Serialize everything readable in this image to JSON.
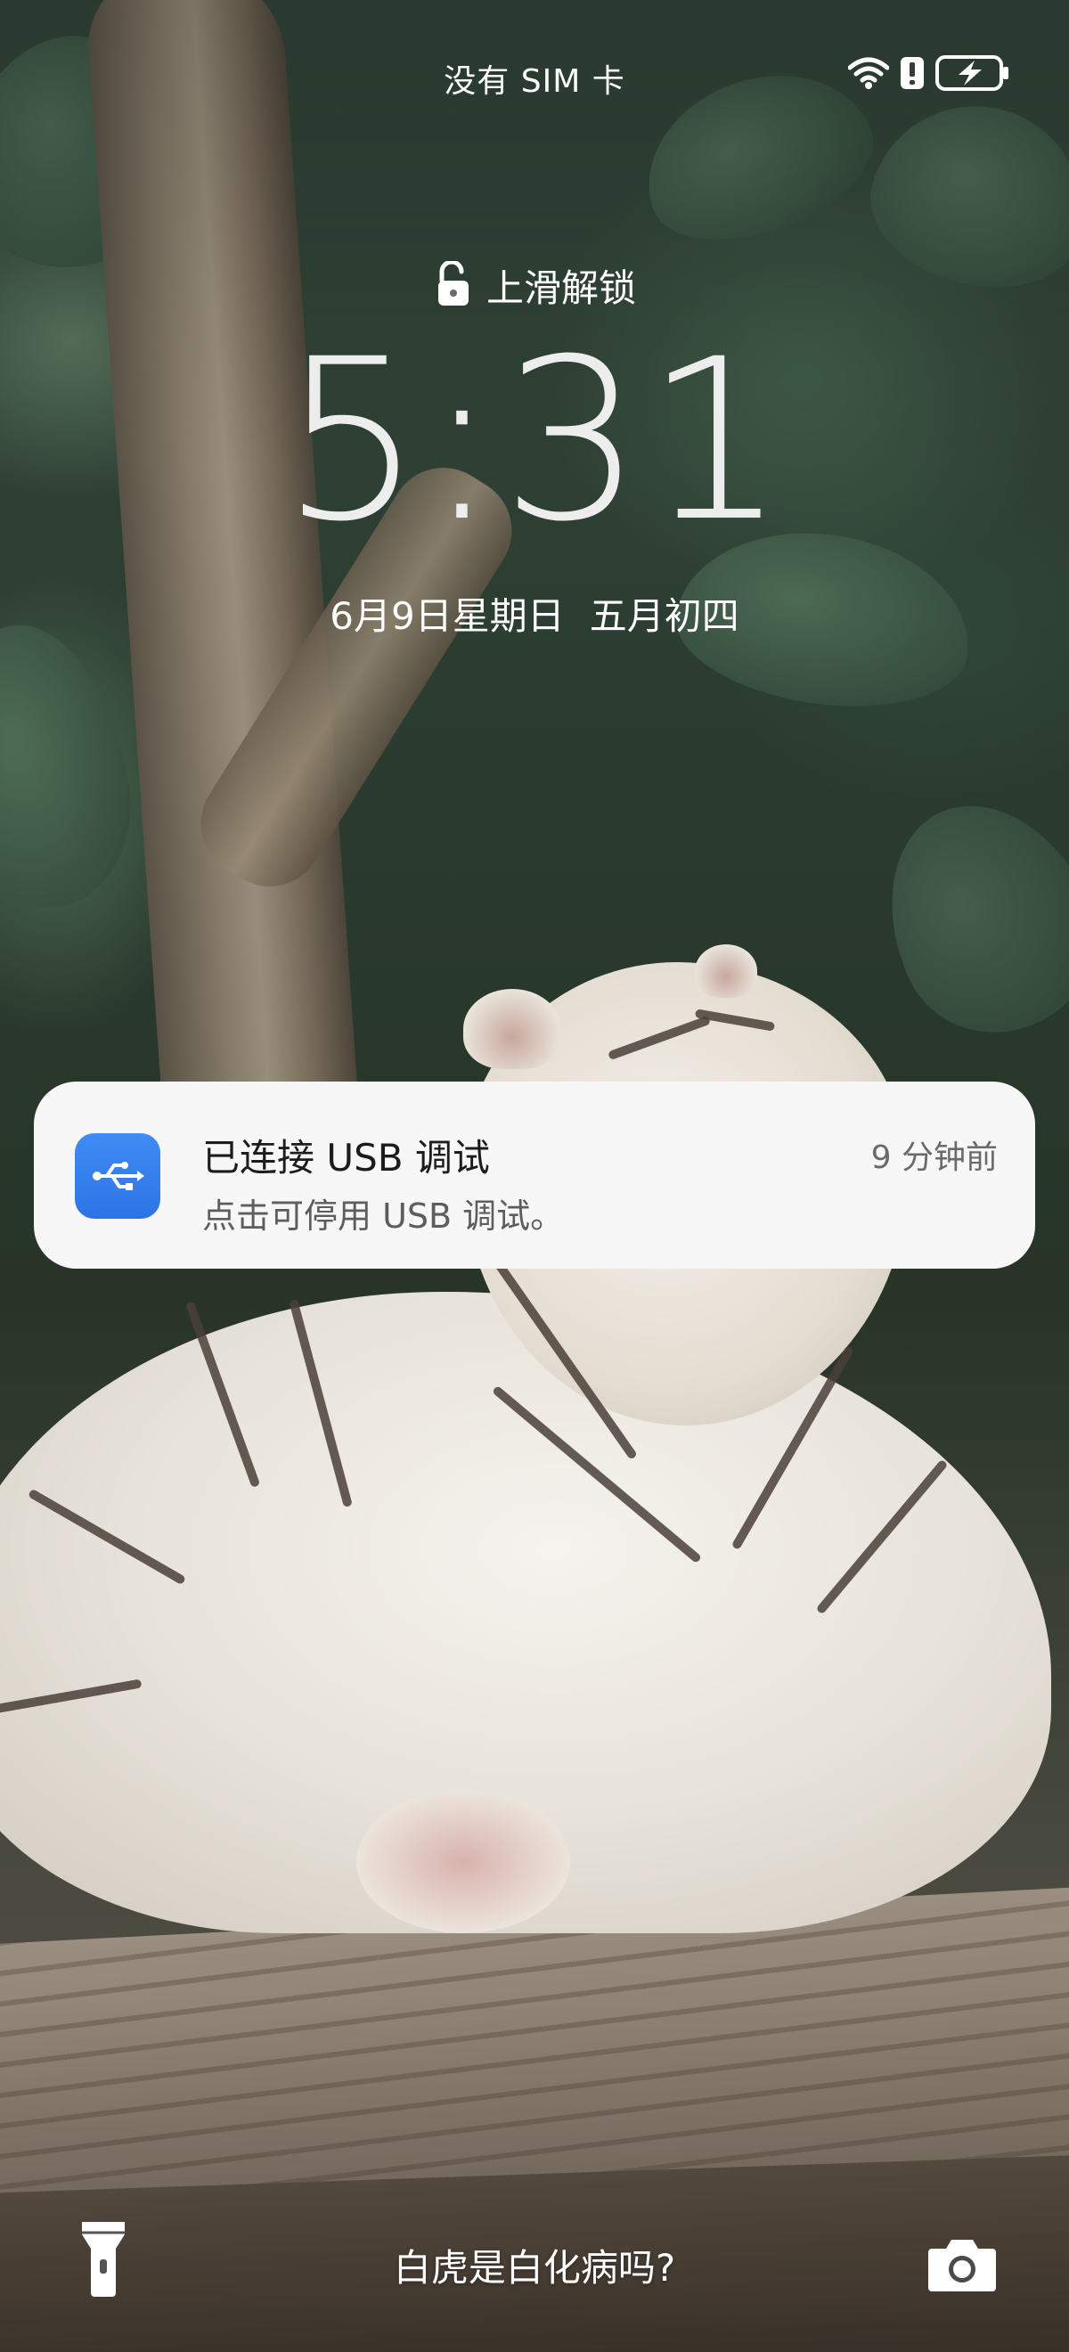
{
  "status_bar": {
    "carrier": "没有 SIM 卡",
    "icons": [
      "wifi-icon",
      "alert-icon",
      "battery-charging-icon"
    ]
  },
  "lock_screen": {
    "unlock_hint": "上滑解锁",
    "time": "5:31",
    "date": "6月9日星期日",
    "lunar_date": "五月初四"
  },
  "notification": {
    "icon": "usb-icon",
    "icon_color": "#3a83f0",
    "title": "已连接 USB 调试",
    "body": "点击可停用 USB 调试。",
    "time": "9 分钟前"
  },
  "bottom_bar": {
    "left_icon": "flashlight-icon",
    "caption": "白虎是白化病吗?",
    "right_icon": "camera-icon"
  }
}
